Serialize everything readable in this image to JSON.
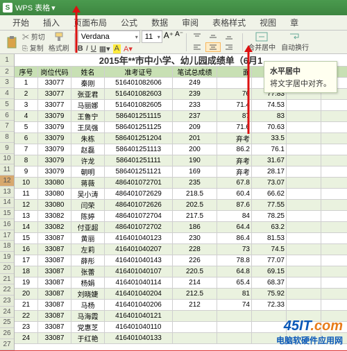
{
  "app": {
    "name": "WPS 表格"
  },
  "menu": [
    "开始",
    "插入",
    "页面布局",
    "公式",
    "数据",
    "审阅",
    "表格样式",
    "视图",
    "章"
  ],
  "toolbar": {
    "cut": "剪切",
    "copy": "复制",
    "fmtpaint": "格式刷",
    "font": "Verdana",
    "size": "11",
    "merge": "合并居中",
    "wrap": "自动换行"
  },
  "tooltip": {
    "title": "水平居中",
    "body": "将文字居中对齐。"
  },
  "sheet": {
    "title": "2015年**市中小学、幼儿园成绩单（6月1",
    "headers": [
      "序号",
      "岗位代码",
      "姓名",
      "准考证号",
      "笔试总成绩",
      "面",
      "",
      ""
    ],
    "rows": [
      [
        "1",
        "33077",
        "秦刚",
        "516401082606",
        "249",
        "",
        "",
        ""
      ],
      [
        "2",
        "33077",
        "张亚君",
        "516401082603",
        "239",
        "76",
        "77.83",
        ""
      ],
      [
        "3",
        "33077",
        "马丽娜",
        "516401082605",
        "233",
        "71.4",
        "74.53",
        ""
      ],
      [
        "4",
        "33079",
        "王鲁宁",
        "586401251115",
        "237",
        "87",
        "83",
        ""
      ],
      [
        "5",
        "33079",
        "王凤强",
        "586401251125",
        "209",
        "71.6",
        "70.63",
        ""
      ],
      [
        "6",
        "33079",
        "朱栋",
        "586401251204",
        "201",
        "弃考",
        "33.5",
        ""
      ],
      [
        "7",
        "33079",
        "赵磊",
        "586401251113",
        "200",
        "86.2",
        "76.1",
        ""
      ],
      [
        "8",
        "33079",
        "许龙",
        "586401251111",
        "190",
        "弃考",
        "31.67",
        ""
      ],
      [
        "9",
        "33079",
        "朝明",
        "586401251121",
        "169",
        "弃考",
        "28.17",
        ""
      ],
      [
        "10",
        "33080",
        "蒋薇",
        "486401072701",
        "235",
        "67.8",
        "73.07",
        ""
      ],
      [
        "11",
        "33080",
        "吴小涛",
        "486401072629",
        "218.5",
        "60.4",
        "66.62",
        ""
      ],
      [
        "12",
        "33080",
        "闫荣",
        "486401072626",
        "202.5",
        "87.6",
        "77.55",
        ""
      ],
      [
        "13",
        "33082",
        "陈婷",
        "486401072704",
        "217.5",
        "84",
        "78.25",
        ""
      ],
      [
        "14",
        "33082",
        "付亚超",
        "486401072702",
        "186",
        "64.4",
        "63.2",
        ""
      ],
      [
        "15",
        "33087",
        "黄丽",
        "416401040123",
        "230",
        "86.4",
        "81.53",
        ""
      ],
      [
        "16",
        "33087",
        "左莉",
        "416401040207",
        "228",
        "73",
        "74.5",
        ""
      ],
      [
        "17",
        "33087",
        "薛彤",
        "416401040143",
        "226",
        "78.8",
        "77.07",
        ""
      ],
      [
        "18",
        "33087",
        "张蕾",
        "416401040107",
        "220.5",
        "64.8",
        "69.15",
        ""
      ],
      [
        "19",
        "33087",
        "杨娟",
        "416401040114",
        "214",
        "65.4",
        "68.37",
        ""
      ],
      [
        "20",
        "33087",
        "刘晓婕",
        "416401040204",
        "212.5",
        "81",
        "75.92",
        ""
      ],
      [
        "21",
        "33087",
        "马杨",
        "416401040206",
        "212",
        "74",
        "72.33",
        ""
      ],
      [
        "22",
        "33087",
        "马海霞",
        "416401040121",
        "",
        "",
        "",
        ""
      ],
      [
        "23",
        "33087",
        "党惠芝",
        "416401040110",
        "",
        "",
        "",
        ""
      ],
      [
        "24",
        "33087",
        "于红艳",
        "416401040133",
        "",
        "",
        "",
        ""
      ]
    ],
    "selected_row_index": 9
  },
  "watermark": {
    "brand": "45IT.com",
    "sub": "电脑软硬件应用网"
  }
}
